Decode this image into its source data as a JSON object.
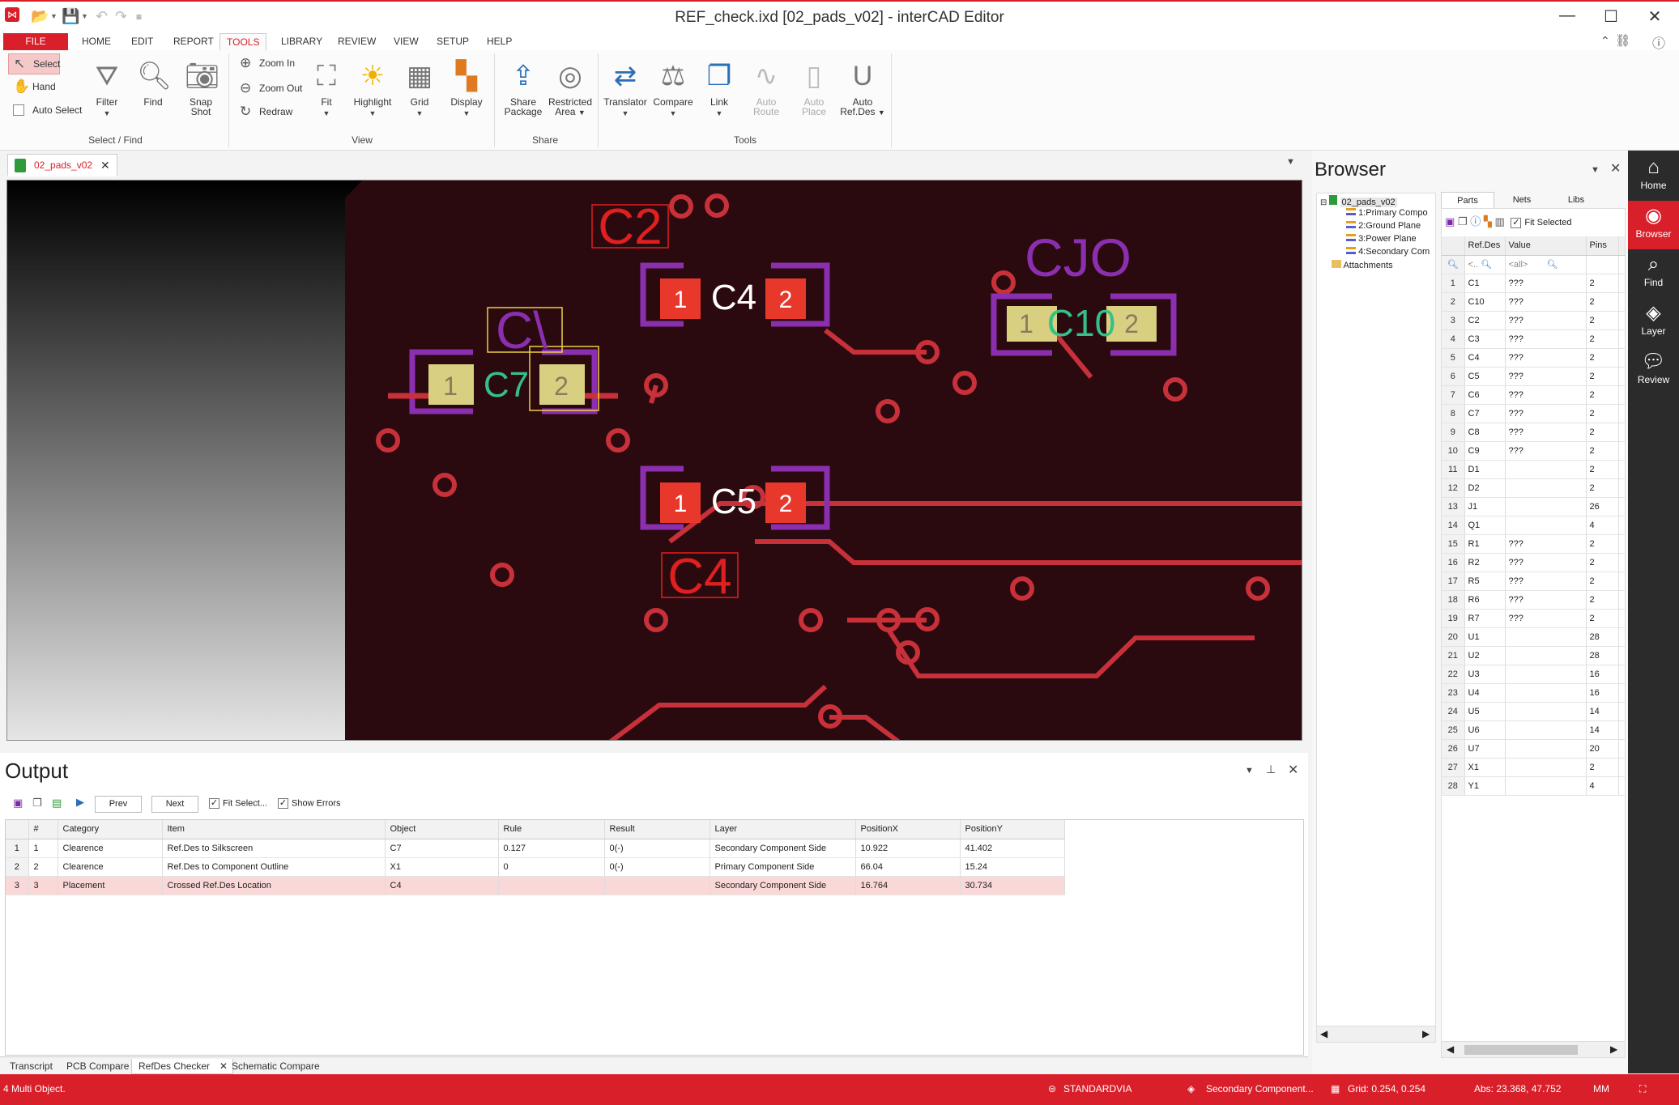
{
  "window": {
    "title": "REF_check.ixd [02_pads_v02] - interCAD Editor"
  },
  "menu": {
    "file": "FILE",
    "home": "HOME",
    "edit": "EDIT",
    "report": "REPORT",
    "tools": "TOOLS",
    "library": "LIBRARY",
    "review": "REVIEW",
    "view": "VIEW",
    "setup": "SETUP",
    "help": "HELP"
  },
  "ribbon": {
    "select_find": {
      "select": "Select",
      "hand": "Hand",
      "auto_select": "Auto Select",
      "filter": "Filter",
      "find": "Find",
      "snap1": "Snap",
      "snap2": "Shot",
      "label": "Select / Find"
    },
    "view": {
      "zoom_in": "Zoom In",
      "zoom_out": "Zoom Out",
      "redraw": "Redraw",
      "fit": "Fit",
      "highlight": "Highlight",
      "grid": "Grid",
      "display": "Display",
      "label": "View"
    },
    "share": {
      "share1": "Share",
      "share2": "Package",
      "restricted1": "Restricted",
      "restricted2": "Area",
      "label": "Share"
    },
    "tools": {
      "translator": "Translator",
      "compare": "Compare",
      "link": "Link",
      "autoroute1": "Auto",
      "autoroute2": "Route",
      "autoplace1": "Auto",
      "autoplace2": "Place",
      "autoref1": "Auto",
      "autoref2": "Ref.Des",
      "label": "Tools"
    }
  },
  "doc_tab": "02_pads_v02",
  "pcb": {
    "labels": {
      "c2": "C2",
      "c4": "C4",
      "c10": "C10",
      "c1": "C1",
      "c7": "C7",
      "c5": "C5",
      "c4b": "C4",
      "cjo": "CJO",
      "c1silk": "C\\"
    },
    "pin1": "1",
    "pin2": "2"
  },
  "browser": {
    "title": "Browser",
    "tree": {
      "root": "02_pads_v02",
      "l1": "1:Primary Compo",
      "l2": "2:Ground Plane",
      "l3": "3:Power Plane",
      "l4": "4:Secondary Com",
      "attachments": "Attachments"
    },
    "tabs": {
      "parts": "Parts",
      "nets": "Nets",
      "libs": "Libs"
    },
    "fit_selected": "Fit Selected",
    "columns": {
      "refdes": "Ref.Des",
      "value": "Value",
      "pins": "Pins"
    },
    "filter": {
      "refdes": "<..",
      "value": "<all>"
    },
    "rows": [
      {
        "n": "1",
        "ref": "C1",
        "val": "???",
        "pins": "2"
      },
      {
        "n": "2",
        "ref": "C10",
        "val": "???",
        "pins": "2"
      },
      {
        "n": "3",
        "ref": "C2",
        "val": "???",
        "pins": "2"
      },
      {
        "n": "4",
        "ref": "C3",
        "val": "???",
        "pins": "2"
      },
      {
        "n": "5",
        "ref": "C4",
        "val": "???",
        "pins": "2"
      },
      {
        "n": "6",
        "ref": "C5",
        "val": "???",
        "pins": "2"
      },
      {
        "n": "7",
        "ref": "C6",
        "val": "???",
        "pins": "2"
      },
      {
        "n": "8",
        "ref": "C7",
        "val": "???",
        "pins": "2"
      },
      {
        "n": "9",
        "ref": "C8",
        "val": "???",
        "pins": "2"
      },
      {
        "n": "10",
        "ref": "C9",
        "val": "???",
        "pins": "2"
      },
      {
        "n": "11",
        "ref": "D1",
        "val": "",
        "pins": "2"
      },
      {
        "n": "12",
        "ref": "D2",
        "val": "",
        "pins": "2"
      },
      {
        "n": "13",
        "ref": "J1",
        "val": "",
        "pins": "26"
      },
      {
        "n": "14",
        "ref": "Q1",
        "val": "",
        "pins": "4"
      },
      {
        "n": "15",
        "ref": "R1",
        "val": "???",
        "pins": "2"
      },
      {
        "n": "16",
        "ref": "R2",
        "val": "???",
        "pins": "2"
      },
      {
        "n": "17",
        "ref": "R5",
        "val": "???",
        "pins": "2"
      },
      {
        "n": "18",
        "ref": "R6",
        "val": "???",
        "pins": "2"
      },
      {
        "n": "19",
        "ref": "R7",
        "val": "???",
        "pins": "2"
      },
      {
        "n": "20",
        "ref": "U1",
        "val": "",
        "pins": "28"
      },
      {
        "n": "21",
        "ref": "U2",
        "val": "",
        "pins": "28"
      },
      {
        "n": "22",
        "ref": "U3",
        "val": "",
        "pins": "16"
      },
      {
        "n": "23",
        "ref": "U4",
        "val": "",
        "pins": "16"
      },
      {
        "n": "24",
        "ref": "U5",
        "val": "",
        "pins": "14"
      },
      {
        "n": "25",
        "ref": "U6",
        "val": "",
        "pins": "14"
      },
      {
        "n": "26",
        "ref": "U7",
        "val": "",
        "pins": "20"
      },
      {
        "n": "27",
        "ref": "X1",
        "val": "",
        "pins": "2"
      },
      {
        "n": "28",
        "ref": "Y1",
        "val": "",
        "pins": "4"
      }
    ]
  },
  "sidebar": {
    "home": "Home",
    "browser": "Browser",
    "find": "Find",
    "layer": "Layer",
    "review": "Review"
  },
  "output": {
    "title": "Output",
    "prev": "Prev",
    "next": "Next",
    "fit_select": "Fit Select...",
    "show_errors": "Show Errors",
    "columns": [
      "#",
      "Category",
      "Item",
      "Object",
      "Rule",
      "Result",
      "Layer",
      "PositionX",
      "PositionY"
    ],
    "rows": [
      {
        "n": "1",
        "num": "1",
        "category": "Clearence",
        "item": "Ref.Des to Silkscreen",
        "object": "C7",
        "rule": "0.127",
        "result": "0(-)",
        "layer": "Secondary Component Side",
        "x": "10.922",
        "y": "41.402"
      },
      {
        "n": "2",
        "num": "2",
        "category": "Clearence",
        "item": "Ref.Des to Component Outline",
        "object": "X1",
        "rule": "0",
        "result": "0(-)",
        "layer": "Primary Component Side",
        "x": "66.04",
        "y": "15.24"
      },
      {
        "n": "3",
        "num": "3",
        "category": "Placement",
        "item": "Crossed Ref.Des Location",
        "object": "C4",
        "rule": "",
        "result": "",
        "layer": "Secondary Component Side",
        "x": "16.764",
        "y": "30.734"
      }
    ]
  },
  "bottom_tabs": {
    "transcript": "Transcript",
    "pcb_compare": "PCB Compare",
    "refdes": "RefDes Checker",
    "schematic": "Schematic Compare"
  },
  "status": {
    "left": "4 Multi Object.",
    "via": "STANDARDVIA",
    "layer": "Secondary Component...",
    "grid": "Grid: 0.254, 0.254",
    "abs": "Abs: 23.368, 47.752",
    "unit": "MM"
  },
  "colors": {
    "accent": "#d81f2a",
    "board": "#2a0a0e",
    "copper": "#c8303a",
    "pad": "#e8382c",
    "silk": "#8b2fb0",
    "highlight": "#d8cf80"
  }
}
